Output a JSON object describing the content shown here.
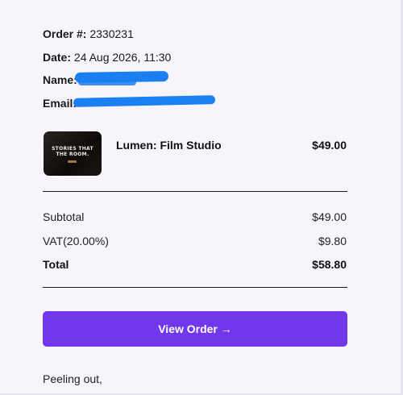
{
  "order": {
    "number_label": "Order #:",
    "number_value": "2330231",
    "date_label": "Date:",
    "date_value": "24 Aug 2026, 11:30",
    "name_label": "Name:",
    "email_label": "Email:"
  },
  "item": {
    "thumbnail_line1": "STORIES THAT",
    "thumbnail_line2": "THE ROOM.",
    "name": "Lumen: Film Studio",
    "price": "$49.00"
  },
  "summary": {
    "subtotal_label": "Subtotal",
    "subtotal_value": "$49.00",
    "vat_label": "VAT(20.00%)",
    "vat_value": "$9.80",
    "total_label": "Total",
    "total_value": "$58.80"
  },
  "cta": {
    "label": "View Order →"
  },
  "footer": {
    "signoff": "Peeling out,"
  },
  "colors": {
    "background": "#f7f5fb",
    "accent": "#7137ea",
    "redaction": "#1a7ff0"
  }
}
